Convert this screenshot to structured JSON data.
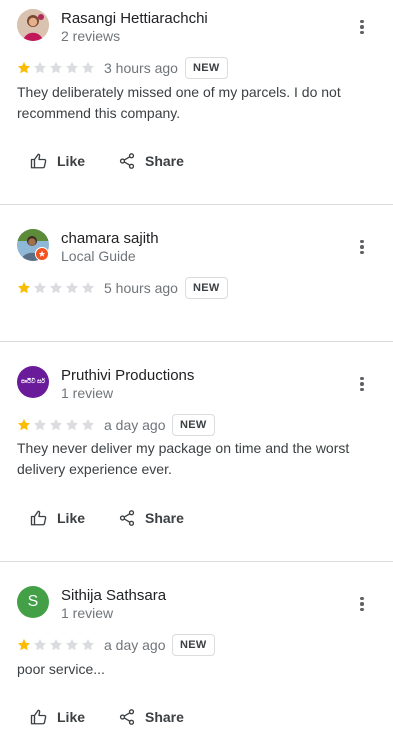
{
  "colors": {
    "star_filled": "#fbbc04",
    "star_empty": "#dadce0",
    "secondary_text": "#70757a",
    "divider": "#dadce0"
  },
  "reviews": [
    {
      "author": "Rasangi Hettiarachchi",
      "meta": "2 reviews",
      "rating": 1,
      "date": "3 hours ago",
      "badge": "NEW",
      "text": "They deliberately missed one of my parcels. I do not recommend this company.",
      "like_label": "Like",
      "share_label": "Share"
    },
    {
      "author": "chamara sajith",
      "meta": "Local Guide",
      "rating": 1,
      "date": "5 hours ago",
      "badge": "NEW"
    },
    {
      "author": "Pruthivi Productions",
      "meta": "1 review",
      "avatar_text": "පෘථිවි සර්",
      "rating": 1,
      "date": "a day ago",
      "badge": "NEW",
      "text": "They never deliver my package on time and the worst delivery experience ever.",
      "like_label": "Like",
      "share_label": "Share"
    },
    {
      "author": "Sithija Sathsara",
      "meta": "1 review",
      "avatar_letter": "S",
      "rating": 1,
      "date": "a day ago",
      "badge": "NEW",
      "text": "poor service...",
      "like_label": "Like",
      "share_label": "Share"
    }
  ]
}
